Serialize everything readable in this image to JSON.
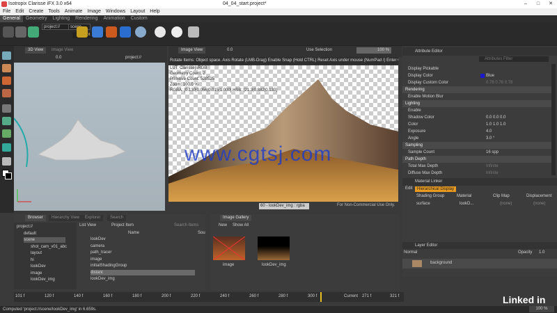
{
  "window": {
    "title": "Isotropix Clarisse iFX 3.0 x64",
    "project": "04_04_start.project*",
    "minimize": "–",
    "maximize": "□",
    "close": "✕"
  },
  "menu": [
    "File",
    "Edit",
    "Create",
    "Tools",
    "Animate",
    "Image",
    "Windows",
    "Layout",
    "Help"
  ],
  "tabs": [
    {
      "label": "General",
      "active": true
    },
    {
      "label": "Geometry"
    },
    {
      "label": "Lighting"
    },
    {
      "label": "Rendering"
    },
    {
      "label": "Animation"
    },
    {
      "label": "Custom"
    }
  ],
  "toolbar": {
    "path1": "project://",
    "path2": "scene",
    "path3": "distant"
  },
  "view3d": {
    "tab_active": "3D View",
    "tab_inactive": "Image View",
    "zoom": "0.0",
    "path": "project://"
  },
  "image_view": {
    "tab": "Image View",
    "zoom": "0.0",
    "selection": "Use Selection",
    "percent": "100 %",
    "info_lines": [
      "Rotate Items: Object space. Axis Rotate (LMB-Drag) Enable Snap (Hold CTRL) Reset Axis under mouse (NumPad /) Enter Offs",
      "LUT: Clarisse|sRGB",
      "Geometry Count: 2",
      "Primitive Count: 528525",
      "Zoom: 100.0 %",
      "RGBA: [0.130|0.056|0.015|1.000] HSB: [21.3|0.882|0.130]"
    ],
    "caption": "60 - lookDev_img : rgba",
    "license": "For Non-Commercial Use Only."
  },
  "watermark": "www.cgtsj.com",
  "attribute_editor": {
    "title": "Attribute Editor",
    "filter_placeholder": "Attributes Filter",
    "rows": [
      {
        "type": "row",
        "label": "Display Pickable"
      },
      {
        "type": "row",
        "label": "Display Color",
        "value": "Blue",
        "swatch": "#1a1acc"
      },
      {
        "type": "row",
        "label": "Display Custom Color",
        "value": "0.78   0.78   0.78",
        "dim": true
      },
      {
        "type": "section",
        "label": "Rendering"
      },
      {
        "type": "row",
        "label": "Enable Motion Blur"
      },
      {
        "type": "section",
        "label": "Lighting"
      },
      {
        "type": "row",
        "label": "Enable"
      },
      {
        "type": "row",
        "label": "Shadow Color",
        "value": "0.0    0.0    0.0"
      },
      {
        "type": "row",
        "label": "Color",
        "value": "1.0    1.0    1.0"
      },
      {
        "type": "row",
        "label": "Exposure",
        "value": "4.0"
      },
      {
        "type": "row",
        "label": "Angle",
        "value": "3.0 °"
      },
      {
        "type": "section",
        "label": "Sampling"
      },
      {
        "type": "row",
        "label": "Sample Count",
        "value": "16 spp"
      },
      {
        "type": "section",
        "label": "Path Depth"
      },
      {
        "type": "row",
        "label": "Total Max Depth",
        "value": "Infinite",
        "dim": true
      },
      {
        "type": "row",
        "label": "Diffuse Max Depth",
        "value": "Infinite",
        "dim": true
      }
    ]
  },
  "material_linker": {
    "title": "Material Linker",
    "edit": "Edit",
    "mode": "Hierarchical Display",
    "columns": [
      "Shading Group",
      "Material",
      "Clip Map",
      "Displacement"
    ],
    "row": {
      "name": "surface",
      "material": "lookD...",
      "clip": "(none)",
      "disp": "(none)"
    }
  },
  "layer_editor": {
    "title": "Layer Editor",
    "blend": "Normal",
    "opacity_label": "Opacity",
    "opacity": "1.0",
    "layer": "background"
  },
  "browser": {
    "tabs": [
      "Browser",
      "Hierarchy View",
      "Explorer",
      "Search"
    ],
    "tree": [
      "project://",
      "default",
      "scene",
      "shot_cam_v01_abc",
      "layout",
      "hi",
      "lookDev",
      "image",
      "lookDev_img"
    ],
    "list_view": "List View",
    "project_item": "Project Item",
    "search_placeholder": "Search Items",
    "name_header": "Name",
    "src_header": "Sou",
    "items": [
      "lookDev",
      "camera",
      "path_tracer",
      "image",
      "initialShadingGroup",
      "distant",
      "lookDev_img"
    ]
  },
  "gallery": {
    "tab": "Image Gallery",
    "new": "New",
    "show": "Show All",
    "thumbs": [
      "image",
      "lookDev_img"
    ]
  },
  "timeline": {
    "ticks": [
      "101 f",
      "120 f",
      "140 f",
      "160 f",
      "180 f",
      "200 f",
      "220 f",
      "240 f",
      "260 f",
      "280 f",
      "300 f"
    ],
    "current_label": "Current",
    "current": "271 f",
    "end": "321 f"
  },
  "status": {
    "message": "Computed 'project://scene/lookDev_img' in 6.659s.",
    "logo": "Linked in",
    "zoom": "100 %"
  }
}
